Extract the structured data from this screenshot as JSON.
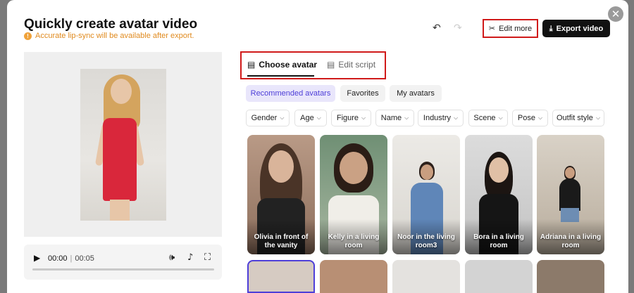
{
  "header": {
    "title": "Quickly create avatar video",
    "notice": "Accurate lip-sync will be available after export.",
    "edit_more": "Edit more",
    "export": "Export video"
  },
  "player": {
    "current": "00:00",
    "separator": "|",
    "total": "00:05"
  },
  "tabs": [
    {
      "label": "Choose avatar",
      "active": true
    },
    {
      "label": "Edit script",
      "active": false
    }
  ],
  "categories": [
    {
      "label": "Recommended avatars",
      "active": true
    },
    {
      "label": "Favorites",
      "active": false
    },
    {
      "label": "My avatars",
      "active": false
    }
  ],
  "filters": [
    {
      "label": "Gender"
    },
    {
      "label": "Age"
    },
    {
      "label": "Figure"
    },
    {
      "label": "Name"
    },
    {
      "label": "Industry"
    },
    {
      "label": "Scene"
    },
    {
      "label": "Pose"
    },
    {
      "label": "Outfit style"
    }
  ],
  "avatars": [
    {
      "label": "Olivia in front of the vanity"
    },
    {
      "label": "Kelly in a living room"
    },
    {
      "label": "Noor in the living room3"
    },
    {
      "label": "Bora in a living room"
    },
    {
      "label": "Adriana in a living room"
    }
  ],
  "colors": {
    "accent": "#4e3fd8",
    "highlight_box": "#d01a1a",
    "notice": "#e08a1e"
  }
}
